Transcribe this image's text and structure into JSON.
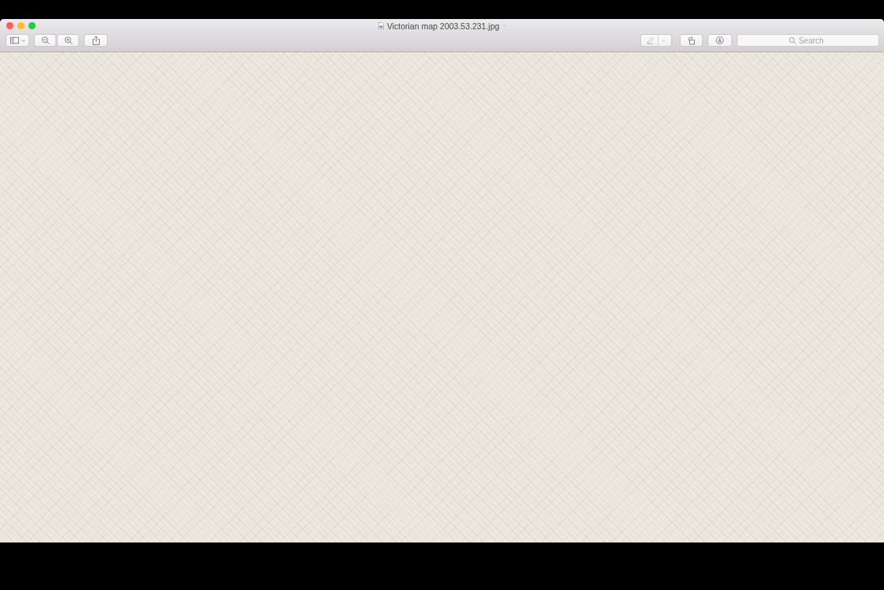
{
  "window": {
    "title": "Victorian map 2003.53.231.jpg"
  },
  "toolbar": {
    "markup": {
      "disabled": true
    },
    "search": {
      "placeholder": "Search"
    }
  }
}
